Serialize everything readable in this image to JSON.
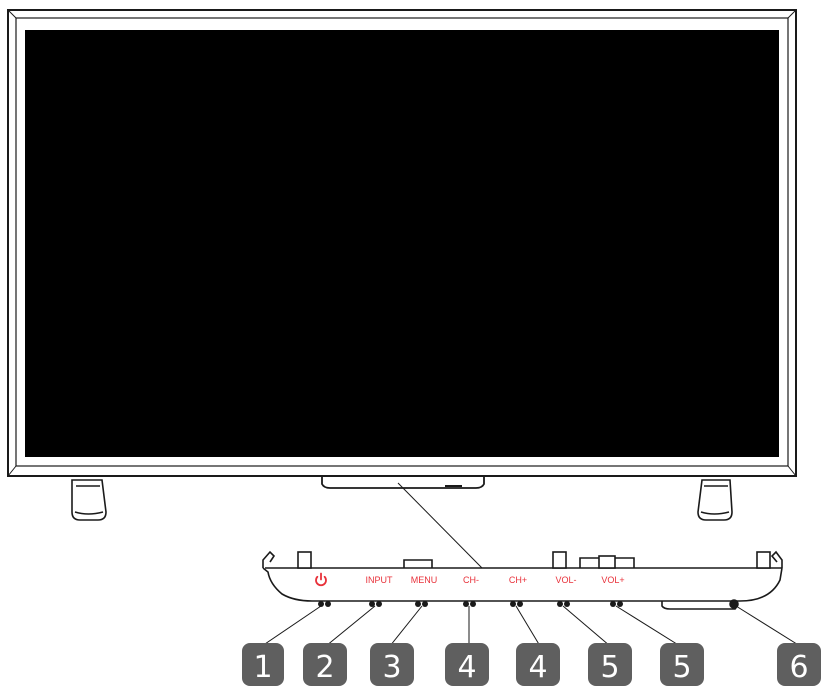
{
  "buttons": [
    {
      "label": "",
      "icon": "power-icon"
    },
    {
      "label": "INPUT"
    },
    {
      "label": "MENU"
    },
    {
      "label": "CH-"
    },
    {
      "label": "CH+"
    },
    {
      "label": "VOL-"
    },
    {
      "label": "VOL+"
    }
  ],
  "callouts": [
    "1",
    "2",
    "3",
    "4",
    "4",
    "5",
    "5",
    "6"
  ],
  "colors": {
    "label_red": "#e8313a",
    "callout_bg": "#5f5f5f",
    "screen": "#000000",
    "outline": "#1a1a1a"
  }
}
